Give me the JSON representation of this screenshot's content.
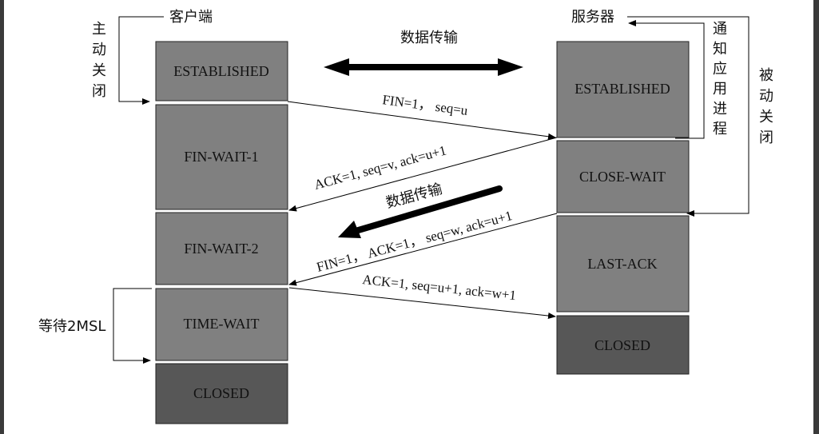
{
  "colors": {
    "state_fill": "#808080",
    "closed_fill": "#575757",
    "border": "#222222",
    "arrow": "#000000"
  },
  "client": {
    "title": "客户端",
    "active_close": "主动关闭",
    "wait_label": "等待2MSL",
    "states": [
      "ESTABLISHED",
      "FIN-WAIT-1",
      "FIN-WAIT-2",
      "TIME-WAIT",
      "CLOSED"
    ]
  },
  "server": {
    "title": "服务器",
    "notify_app": "通知应用进程",
    "passive_close": "被动关闭",
    "states": [
      "ESTABLISHED",
      "CLOSE-WAIT",
      "LAST-ACK",
      "CLOSED"
    ]
  },
  "data_transfer_top": "数据传输",
  "data_transfer_mid": "数据传输",
  "messages": [
    "FIN=1， seq=u",
    "ACK=1, seq=v, ack=u+1",
    "FIN=1， ACK=1， seq=w, ack=u+1",
    "ACK=1, seq=u+1, ack=w+1"
  ]
}
